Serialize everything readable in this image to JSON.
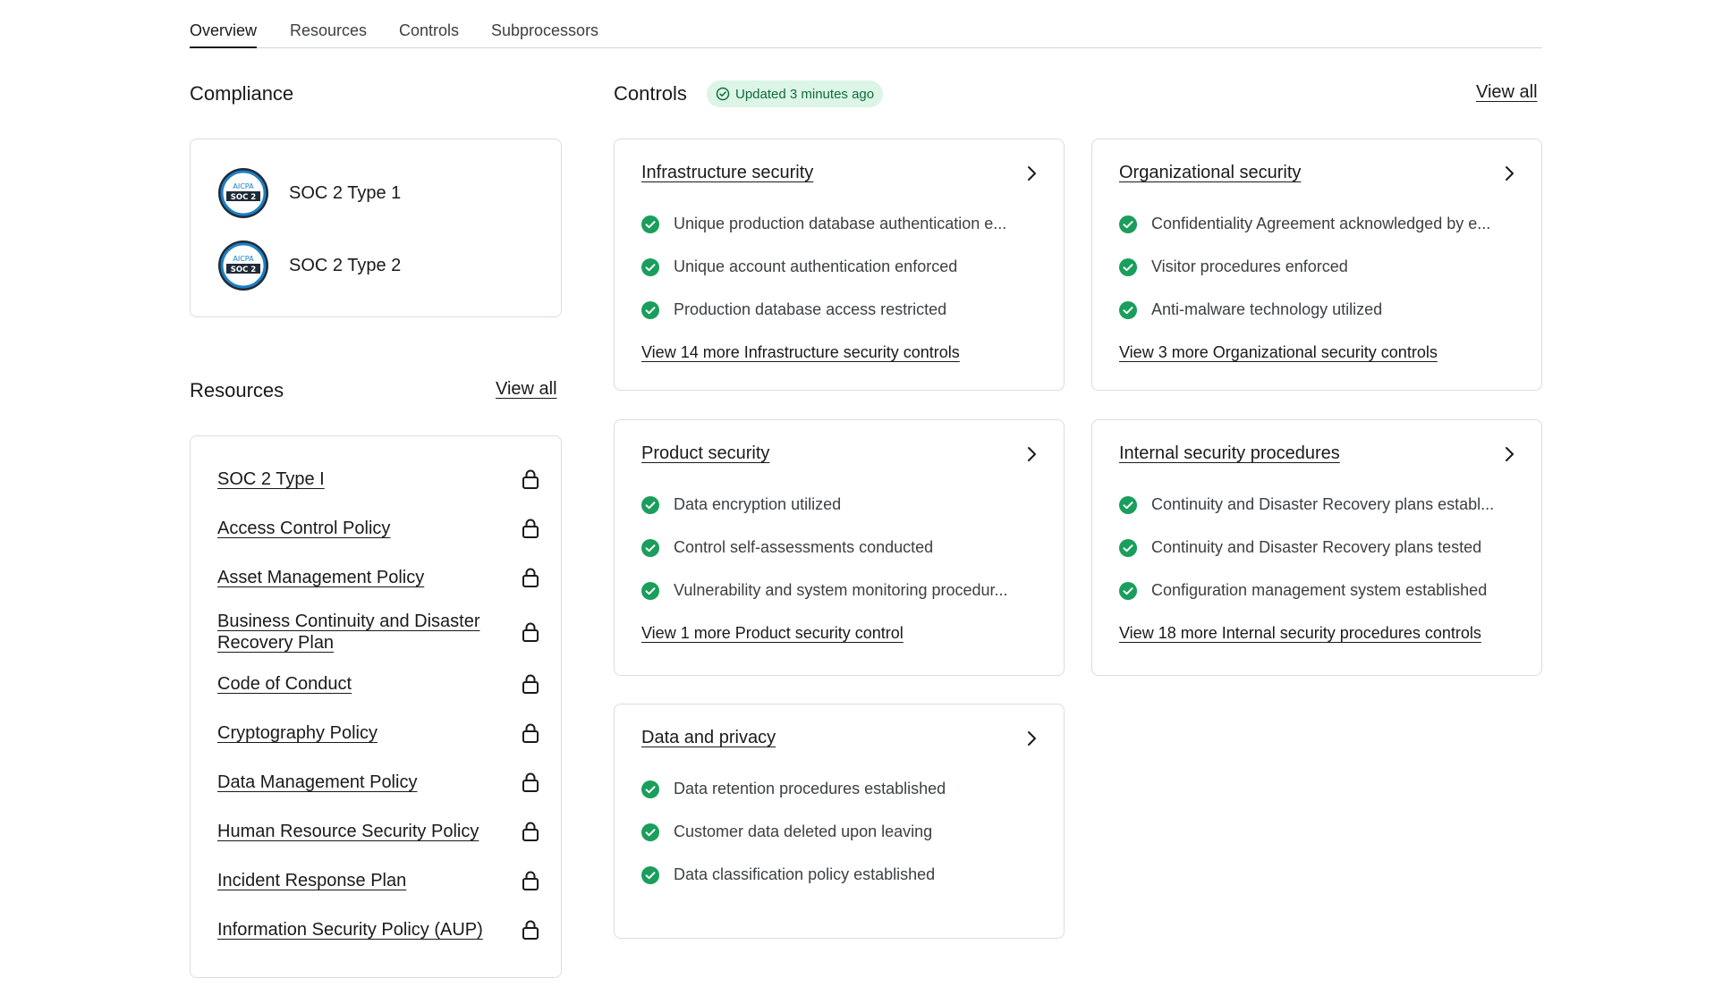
{
  "tabs": [
    {
      "label": "Overview",
      "active": true
    },
    {
      "label": "Resources",
      "active": false
    },
    {
      "label": "Controls",
      "active": false
    },
    {
      "label": "Subprocessors",
      "active": false
    }
  ],
  "compliance": {
    "title": "Compliance",
    "items": [
      {
        "label": "SOC 2 Type 1",
        "badge_top": "AICPA",
        "badge_mid": "SOC 2"
      },
      {
        "label": "SOC 2 Type 2",
        "badge_top": "AICPA",
        "badge_mid": "SOC 2"
      }
    ]
  },
  "resources": {
    "title": "Resources",
    "view_all": "View all",
    "items": [
      {
        "label": "SOC 2 Type I"
      },
      {
        "label": "Access Control Policy"
      },
      {
        "label": "Asset Management Policy"
      },
      {
        "label": "Business Continuity and Disaster Recovery Plan"
      },
      {
        "label": "Code of Conduct"
      },
      {
        "label": "Cryptography Policy"
      },
      {
        "label": "Data Management Policy"
      },
      {
        "label": "Human Resource Security Policy"
      },
      {
        "label": "Incident Response Plan"
      },
      {
        "label": "Information Security Policy (AUP)"
      }
    ]
  },
  "controls": {
    "title": "Controls",
    "updated": "Updated 3 minutes ago",
    "view_all": "View all",
    "cards": [
      {
        "title": "Infrastructure security",
        "items": [
          "Unique production database authentication e...",
          "Unique account authentication enforced",
          "Production database access restricted"
        ],
        "more": "View 14 more Infrastructure security controls"
      },
      {
        "title": "Organizational security",
        "items": [
          "Confidentiality Agreement acknowledged by e...",
          "Visitor procedures enforced",
          "Anti-malware technology utilized"
        ],
        "more": "View 3 more Organizational security controls"
      },
      {
        "title": "Product security",
        "items": [
          "Data encryption utilized",
          "Control self-assessments conducted",
          "Vulnerability and system monitoring procedur..."
        ],
        "more": "View 1 more Product security control"
      },
      {
        "title": "Internal security procedures",
        "items": [
          "Continuity and Disaster Recovery plans establ...",
          "Continuity and Disaster Recovery plans tested",
          "Configuration management system established"
        ],
        "more": "View 18 more Internal security procedures controls"
      },
      {
        "title": "Data and privacy",
        "items": [
          "Data retention procedures established",
          "Customer data deleted upon leaving",
          "Data classification policy established"
        ],
        "more": ""
      }
    ]
  },
  "colors": {
    "check_green": "#1a9e5c",
    "badge_bg": "#dcf5e6",
    "badge_text": "#0f6b3a",
    "card_border": "#d8dde2"
  },
  "icons": {
    "lock": "lock-icon",
    "check": "check-circle-icon",
    "chevron": "chevron-right-icon",
    "badge_check": "check-circle-outline-icon"
  }
}
